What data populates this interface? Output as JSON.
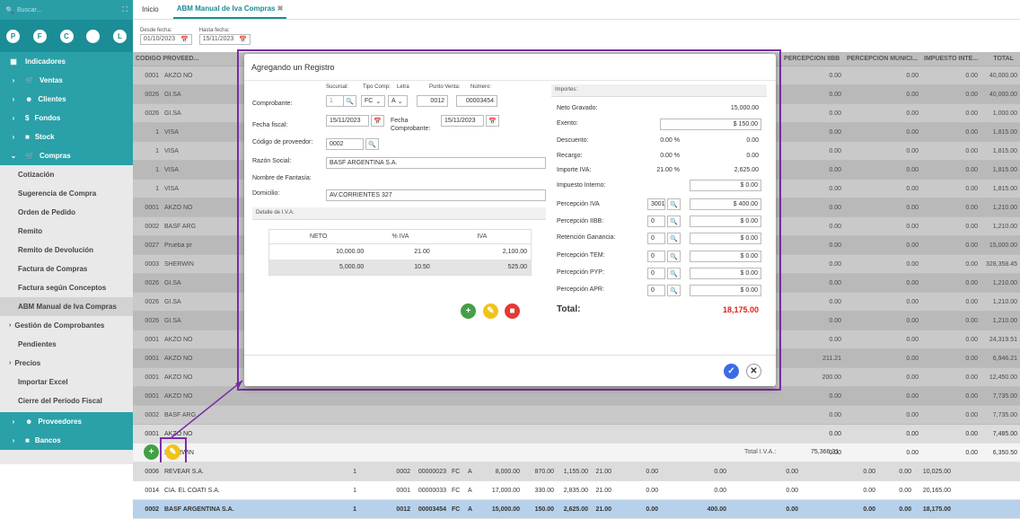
{
  "sidebar": {
    "search_placeholder": "Buscar...",
    "avatars": [
      "P",
      "F",
      "C",
      "",
      "L"
    ],
    "sections": [
      {
        "label": "Indicadores",
        "icon": "dashboard-icon"
      },
      {
        "label": "Ventas",
        "icon": "cart-icon"
      },
      {
        "label": "Clientes",
        "icon": "users-icon"
      },
      {
        "label": "Fondos",
        "icon": "dollar-icon"
      },
      {
        "label": "Stock",
        "icon": "box-icon"
      },
      {
        "label": "Compras",
        "icon": "cart-icon"
      }
    ],
    "compras_items": [
      "Cotización",
      "Sugerencia de Compra",
      "Orden de Pedido",
      "Remito",
      "Remito de Devolución",
      "Factura de Compras",
      "Factura según Conceptos",
      "ABM Manual de Iva Compras",
      "Gestión de Comprobantes",
      "Pendientes",
      "Precios",
      "Importar Excel",
      "Cierre del Período Fiscal"
    ],
    "bottom_sections": [
      "Proveedores",
      "Bancos"
    ]
  },
  "tabs": {
    "inicio": "Inicio",
    "active": "ABM Manual de Iva Compras"
  },
  "filters": {
    "desde_label": "Desde fecha:",
    "desde_value": "01/10/2023",
    "hasta_label": "Hasta fecha:",
    "hasta_value": "15/11/2023"
  },
  "grid": {
    "col_codigo": "CÓDIGO PROVEED...",
    "col_perc_iibb": "PERCEPCIÓN IIBB",
    "col_perc_muni": "PERCEPCIÓN MUNICI...",
    "col_imp_int": "IMPUESTO INTE...",
    "col_total": "TOTAL",
    "rows": [
      {
        "cod": "0001",
        "prov": "AKZO NO",
        "iibb": "0.00",
        "muni": "0.00",
        "ii": "0.00",
        "total": "40,000.00"
      },
      {
        "cod": "0026",
        "prov": "GI.SA",
        "iibb": "0.00",
        "muni": "0.00",
        "ii": "0.00",
        "total": "40,000.00"
      },
      {
        "cod": "0026",
        "prov": "GI.SA",
        "iibb": "0.00",
        "muni": "0.00",
        "ii": "0.00",
        "total": "1,000.00"
      },
      {
        "cod": "1",
        "prov": "VISA",
        "iibb": "0.00",
        "muni": "0.00",
        "ii": "0.00",
        "total": "1,815.00"
      },
      {
        "cod": "1",
        "prov": "VISA",
        "iibb": "0.00",
        "muni": "0.00",
        "ii": "0.00",
        "total": "1,815.00"
      },
      {
        "cod": "1",
        "prov": "VISA",
        "iibb": "0.00",
        "muni": "0.00",
        "ii": "0.00",
        "total": "1,815.00"
      },
      {
        "cod": "1",
        "prov": "VISA",
        "iibb": "0.00",
        "muni": "0.00",
        "ii": "0.00",
        "total": "1,815.00"
      },
      {
        "cod": "0001",
        "prov": "AKZO NO",
        "iibb": "0.00",
        "muni": "0.00",
        "ii": "0.00",
        "total": "1,210.00"
      },
      {
        "cod": "0002",
        "prov": "BASF ARG",
        "iibb": "0.00",
        "muni": "0.00",
        "ii": "0.00",
        "total": "1,210.00"
      },
      {
        "cod": "0027",
        "prov": "Prueba pr",
        "iibb": "0.00",
        "muni": "0.00",
        "ii": "0.00",
        "total": "15,000.00"
      },
      {
        "cod": "0003",
        "prov": "SHERWIN",
        "iibb": "0.00",
        "muni": "0.00",
        "ii": "0.00",
        "total": "328,358.45"
      },
      {
        "cod": "0026",
        "prov": "GI.SA",
        "iibb": "0.00",
        "muni": "0.00",
        "ii": "0.00",
        "total": "1,210.00"
      },
      {
        "cod": "0026",
        "prov": "GI.SA",
        "iibb": "0.00",
        "muni": "0.00",
        "ii": "0.00",
        "total": "1,210.00"
      },
      {
        "cod": "0026",
        "prov": "GI.SA",
        "iibb": "0.00",
        "muni": "0.00",
        "ii": "0.00",
        "total": "1,210.00"
      },
      {
        "cod": "0001",
        "prov": "AKZO NO",
        "iibb": "0.00",
        "muni": "0.00",
        "ii": "0.00",
        "total": "24,319.51"
      },
      {
        "cod": "0001",
        "prov": "AKZO NO",
        "iibb": "211.21",
        "muni": "0.00",
        "ii": "0.00",
        "total": "6,946.21"
      },
      {
        "cod": "0001",
        "prov": "AKZO NO",
        "iibb": "200.00",
        "muni": "0.00",
        "ii": "0.00",
        "total": "12,450.00"
      },
      {
        "cod": "0001",
        "prov": "AKZO NO",
        "iibb": "0.00",
        "muni": "0.00",
        "ii": "0.00",
        "total": "7,735.00"
      },
      {
        "cod": "0002",
        "prov": "BASF ARG",
        "iibb": "0.00",
        "muni": "0.00",
        "ii": "0.00",
        "total": "7,735.00"
      },
      {
        "cod": "0001",
        "prov": "AKZO NO",
        "iibb": "0.00",
        "muni": "0.00",
        "ii": "0.00",
        "total": "7,485.00"
      },
      {
        "cod": "0003",
        "prov": "SHERWIN",
        "iibb": "0.00",
        "muni": "0.00",
        "ii": "0.00",
        "total": "6,350.50"
      }
    ],
    "full_rows": [
      {
        "cod": "0006",
        "prov": "REVEAR S.A.",
        "n": "1",
        "pv": "0002",
        "num": "00000023",
        "tc": "FC",
        "l": "A",
        "neto": "8,000.00",
        "ex": "870.00",
        "iva": "1,155.00",
        "pct": "21.00",
        "a": "0.00",
        "b": "0.00",
        "iibb": "0.00",
        "muni": "0.00",
        "ii": "0.00",
        "total": "10,025.00"
      },
      {
        "cod": "0014",
        "prov": "CIA. EL COATI S.A.",
        "n": "1",
        "pv": "0001",
        "num": "00000033",
        "tc": "FC",
        "l": "A",
        "neto": "17,000.00",
        "ex": "330.00",
        "iva": "2,835.00",
        "pct": "21.00",
        "a": "0.00",
        "b": "0.00",
        "iibb": "0.00",
        "muni": "0.00",
        "ii": "0.00",
        "total": "20,165.00"
      },
      {
        "cod": "0002",
        "prov": "BASF ARGENTINA S.A.",
        "n": "1",
        "pv": "0012",
        "num": "00003454",
        "tc": "FC",
        "l": "A",
        "neto": "15,000.00",
        "ex": "150.00",
        "iva": "2,625.00",
        "pct": "21.00",
        "a": "0.00",
        "b": "400.00",
        "iibb": "0.00",
        "muni": "0.00",
        "ii": "0.00",
        "total": "18,175.00"
      }
    ],
    "total_iva_label": "Total I.V.A.:",
    "total_iva_value": "75,366.31"
  },
  "modal": {
    "title": "Agregando un Registro",
    "sucursal_label": "Sucursal:",
    "tipo_comp_label": "Tipo Comp:",
    "letra_label": "Letra",
    "punto_venta_label": "Punto Venta:",
    "numero_label": "Número:",
    "comprobante_label": "Comprobante:",
    "sucursal_value": "1",
    "tipo_comp_value": "FC",
    "letra_value": "A",
    "punto_venta_value": "0012",
    "numero_value": "00003454",
    "fecha_fiscal_label": "Fecha fiscal:",
    "fecha_fiscal_value": "15/11/2023",
    "fecha_comp_label": "Fecha Comprobante:",
    "fecha_comp_value": "15/11/2023",
    "cod_prov_label": "Código de proveedor:",
    "cod_prov_value": "0002",
    "razon_label": "Razón Social:",
    "razon_value": "BASF ARGENTINA S.A.",
    "fantasia_label": "Nombre de Fantasía:",
    "domicilio_label": "Domicilio:",
    "domicilio_value": "AV.CORRIENTES 327",
    "detalle_title": "Detalle de I.V.A.",
    "detalle_cols": [
      "NETO",
      "% IVA",
      "IVA"
    ],
    "detalle_rows": [
      [
        "10,000.00",
        "21.00",
        "2,100.00"
      ],
      [
        "5,000.00",
        "10.50",
        "525.00"
      ]
    ],
    "importes_title": "Importes:",
    "neto_label": "Neto Gravado:",
    "neto_value": "15,000.00",
    "exento_label": "Exento:",
    "exento_value": "$ 150.00",
    "descuento_label": "Descuento:",
    "descuento_pct": "0.00 %",
    "descuento_value": "0.00",
    "recargo_label": "Recargo:",
    "recargo_pct": "0.00 %",
    "recargo_value": "0.00",
    "importe_iva_label": "Importe IVA:",
    "importe_iva_pct": "21.00 %",
    "importe_iva_value": "2,625.00",
    "imp_interno_label": "Impuesto Interno:",
    "imp_interno_value": "$ 0.00",
    "perc_iva_label": "Percepción IVA",
    "perc_iva_code": "3001",
    "perc_iva_value": "$ 400.00",
    "perc_iibb_label": "Percepción IIBB:",
    "perc_iibb_code": "0",
    "perc_iibb_value": "$ 0.00",
    "ret_gan_label": "Retención Ganancia:",
    "ret_gan_code": "0",
    "ret_gan_value": "$ 0.00",
    "perc_tem_label": "Percepción TEM:",
    "perc_tem_code": "0",
    "perc_tem_value": "$ 0.00",
    "perc_pyp_label": "Percepción PYP:",
    "perc_pyp_code": "0",
    "perc_pyp_value": "$ 0.00",
    "perc_apr_label": "Percepción APR:",
    "perc_apr_code": "0",
    "perc_apr_value": "$ 0.00",
    "total_label": "Total:",
    "total_value": "18,175.00"
  },
  "colors": {
    "teal": "#2aa0a8",
    "highlight": "#7a2ea6",
    "total_red": "#e02020"
  }
}
